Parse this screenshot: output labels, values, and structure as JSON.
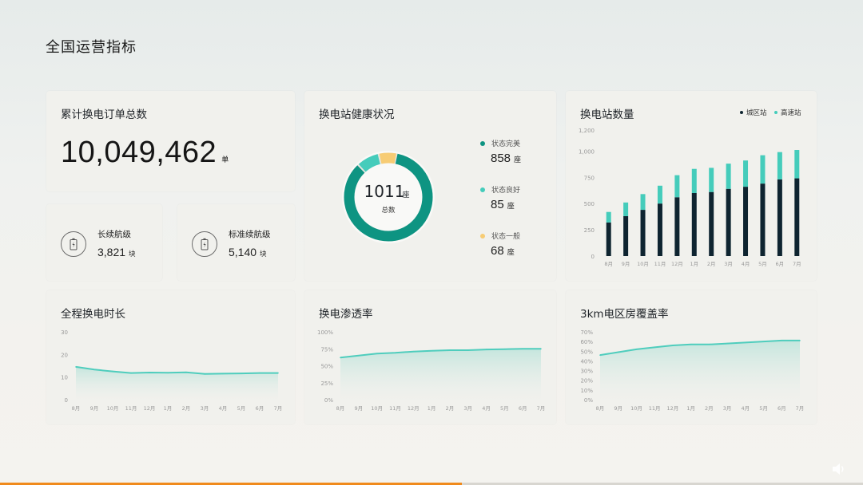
{
  "page_title": "全国运营指标",
  "colors": {
    "teal_dark": "#0e9482",
    "teal": "#45ccbb",
    "yellow": "#f7cc74",
    "navy": "#0e2430",
    "line": "#4fcdbd",
    "progress": "#f08a1c"
  },
  "orders_card": {
    "title": "累计换电订单总数",
    "value": "10,049,462",
    "unit": "单"
  },
  "battery_long": {
    "label": "长续航级",
    "value": "3,821",
    "unit": "块",
    "icon": "battery-icon"
  },
  "battery_std": {
    "label": "标准续航级",
    "value": "5,140",
    "unit": "块",
    "icon": "battery-icon"
  },
  "health_card": {
    "title": "换电站健康状况",
    "total_value": "1011",
    "total_unit": "座",
    "total_label": "总数",
    "items": [
      {
        "label": "状态完美",
        "value": "858",
        "unit": "座",
        "num": 858,
        "color": "#0e9482"
      },
      {
        "label": "状态良好",
        "value": "85",
        "unit": "座",
        "num": 85,
        "color": "#45ccbb"
      },
      {
        "label": "状态一般",
        "value": "68",
        "unit": "座",
        "num": 68,
        "color": "#f7cc74"
      }
    ]
  },
  "stations_card": {
    "title": "换电站数量",
    "legend": [
      "城区站",
      "高速站"
    ]
  },
  "duration_card": {
    "title": "全程换电时长"
  },
  "penetration_card": {
    "title": "换电渗透率"
  },
  "coverage_card": {
    "title": "3km电区房覆盖率"
  },
  "progress": 0.535,
  "chart_data": [
    {
      "type": "bar",
      "title": "换电站数量",
      "categories": [
        "8月",
        "9月",
        "10月",
        "11月",
        "12月",
        "1月",
        "2月",
        "3月",
        "4月",
        "5月",
        "6月",
        "7月"
      ],
      "stacked": true,
      "series": [
        {
          "name": "城区站",
          "color": "#0e2430",
          "values": [
            320,
            380,
            440,
            500,
            560,
            600,
            610,
            640,
            660,
            690,
            730,
            740
          ]
        },
        {
          "name": "高速站",
          "color": "#45ccbb",
          "values": [
            100,
            130,
            150,
            170,
            210,
            230,
            230,
            240,
            250,
            270,
            260,
            270
          ]
        }
      ],
      "ylim": [
        0,
        1200
      ],
      "yticks": [
        "1,200",
        "1,000",
        "750",
        "500",
        "250",
        "0"
      ],
      "ytick_values": [
        1200,
        1000,
        750,
        500,
        250,
        0
      ]
    },
    {
      "type": "area",
      "title": "全程换电时长",
      "categories": [
        "8月",
        "9月",
        "10月",
        "11月",
        "12月",
        "1月",
        "2月",
        "3月",
        "4月",
        "5月",
        "6月",
        "7月"
      ],
      "values": [
        14.5,
        13.3,
        12.5,
        11.8,
        12.0,
        11.9,
        12.1,
        11.4,
        11.5,
        11.6,
        11.8,
        11.8
      ],
      "ylim": [
        0,
        30
      ],
      "yticks": [
        "30",
        "20",
        "10",
        "0"
      ],
      "ytick_values": [
        30,
        20,
        10,
        0
      ]
    },
    {
      "type": "area",
      "title": "换电渗透率",
      "categories": [
        "8月",
        "9月",
        "10月",
        "11月",
        "12月",
        "1月",
        "2月",
        "3月",
        "4月",
        "5月",
        "6月",
        "7月"
      ],
      "values": [
        62,
        65,
        68,
        69,
        71,
        72,
        73,
        73,
        74,
        74.5,
        75,
        75
      ],
      "ylim": [
        0,
        100
      ],
      "yticks": [
        "100%",
        "75%",
        "50%",
        "25%",
        "0%"
      ],
      "ytick_values": [
        100,
        75,
        50,
        25,
        0
      ]
    },
    {
      "type": "area",
      "title": "3km电区房覆盖率",
      "categories": [
        "8月",
        "9月",
        "10月",
        "11月",
        "12月",
        "1月",
        "2月",
        "3月",
        "4月",
        "5月",
        "6月",
        "7月"
      ],
      "values": [
        46,
        49,
        52,
        54,
        56,
        57,
        57,
        58,
        59,
        60,
        61,
        61
      ],
      "ylim": [
        0,
        70
      ],
      "yticks": [
        "70%",
        "60%",
        "50%",
        "40%",
        "30%",
        "20%",
        "10%",
        "0%"
      ],
      "ytick_values": [
        70,
        60,
        50,
        40,
        30,
        20,
        10,
        0
      ]
    }
  ]
}
